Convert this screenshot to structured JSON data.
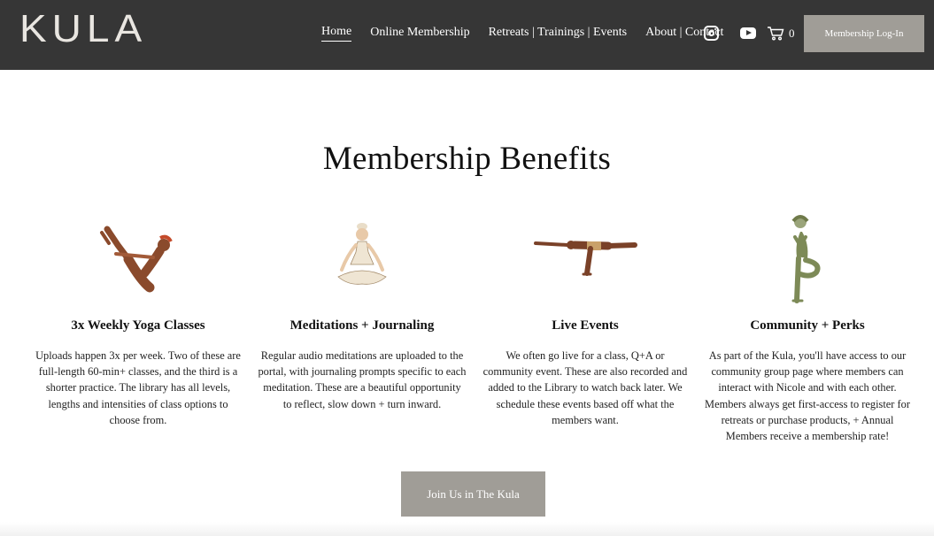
{
  "header": {
    "logo": "KULA",
    "nav": [
      {
        "label": "Home",
        "active": true
      },
      {
        "label": "Online Membership",
        "active": false
      },
      {
        "label": "Retreats | Trainings | Events",
        "active": false
      },
      {
        "label": "About | Contact",
        "active": false
      }
    ],
    "icons": [
      "instagram-icon",
      "youtube-icon",
      "cart-icon"
    ],
    "cart_count": "0",
    "login_label": "Membership Log-In"
  },
  "main": {
    "title": "Membership Benefits",
    "benefits": [
      {
        "heading": "3x Weekly Yoga Classes",
        "text": "Uploads happen 3x per week. Two of these are full-length 60-min+ classes, and the third is a shorter practice. The library has all levels, lengths and intensities of class options to choose from.",
        "icon": "boat-pose-illustration"
      },
      {
        "heading": "Meditations + Journaling",
        "text": "Regular audio meditations are uploaded to the portal, with journaling prompts specific to each meditation. These are a beautiful opportunity to reflect, slow down + turn inward.",
        "icon": "meditation-illustration"
      },
      {
        "heading": "Live Events",
        "text": "We often go live for a class, Q+A or community event. These are also recorded and added to the Library to watch back later. We schedule these events based off what the members want.",
        "icon": "warrior-three-illustration"
      },
      {
        "heading": "Community + Perks",
        "text": "As part of the Kula, you'll have access to our community group page where members can interact with Nicole and with each other. Members always get first-access to register for retreats or purchase products, + Annual Members receive a membership rate!",
        "icon": "tree-pose-illustration"
      }
    ],
    "cta_label": "Join Us in The Kula"
  },
  "colors": {
    "header_bg": "#363636",
    "button_bg": "#a09d97",
    "skin_dark": "#8a4a2c",
    "olive": "#7d8a57"
  }
}
